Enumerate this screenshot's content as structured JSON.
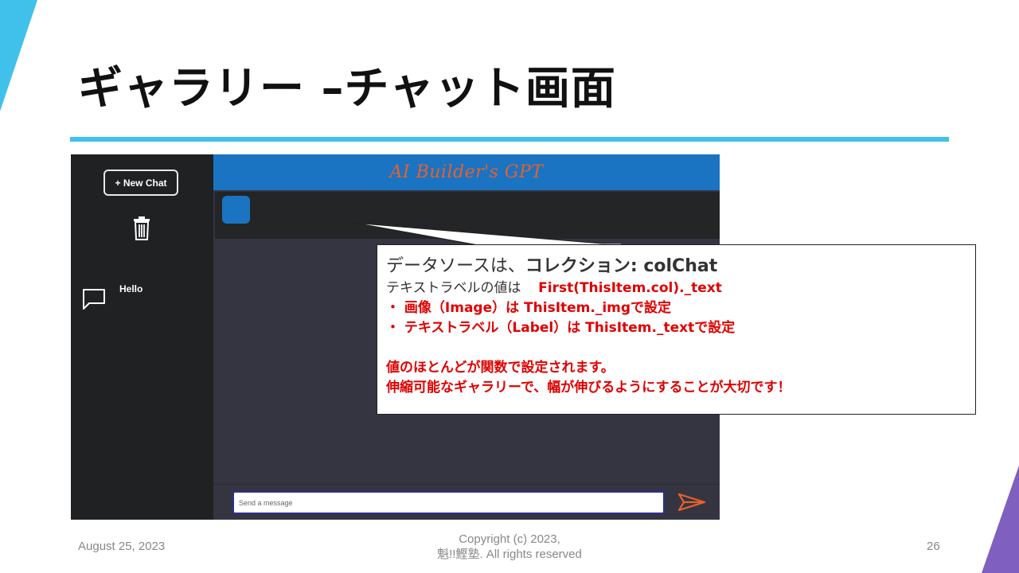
{
  "slide": {
    "title": "ギャラリー –チャット画面",
    "accent_color": "#3fc1ec",
    "corner_color": "#7f5fc0"
  },
  "app": {
    "title": "AI Builder's GPT",
    "header_color": "#1a74c1",
    "title_color": "#e8602c",
    "sidebar": {
      "new_chat_label": "+ New Chat",
      "delete_icon": "trash-icon",
      "chats": [
        {
          "label": "Hello",
          "icon": "chat-bubble-icon"
        }
      ]
    },
    "input": {
      "placeholder": "Send a message",
      "send_icon": "send-icon"
    }
  },
  "callout": {
    "line1_prefix": "データソースは、",
    "line1_bold": "コレクション: colChat",
    "line2_prefix": "テキストラベルの値は",
    "line2_value": "First(ThisItem.col)._text",
    "bullet1": "・ 画像（Image）は ThisItem._imgで設定",
    "bullet2": "・ テキストラベル（Label）は ThisItem._textで設定",
    "note1": "値のほとんどが関数で設定されます。",
    "note2": "伸縮可能なギャラリーで、幅が伸びるようにすることが大切です！"
  },
  "footer": {
    "date": "August 25, 2023",
    "copyright_line1": "Copyright (c) 2023,",
    "copyright_line2": "魁!!鰹塾. All rights reserved",
    "page_number": "26"
  }
}
